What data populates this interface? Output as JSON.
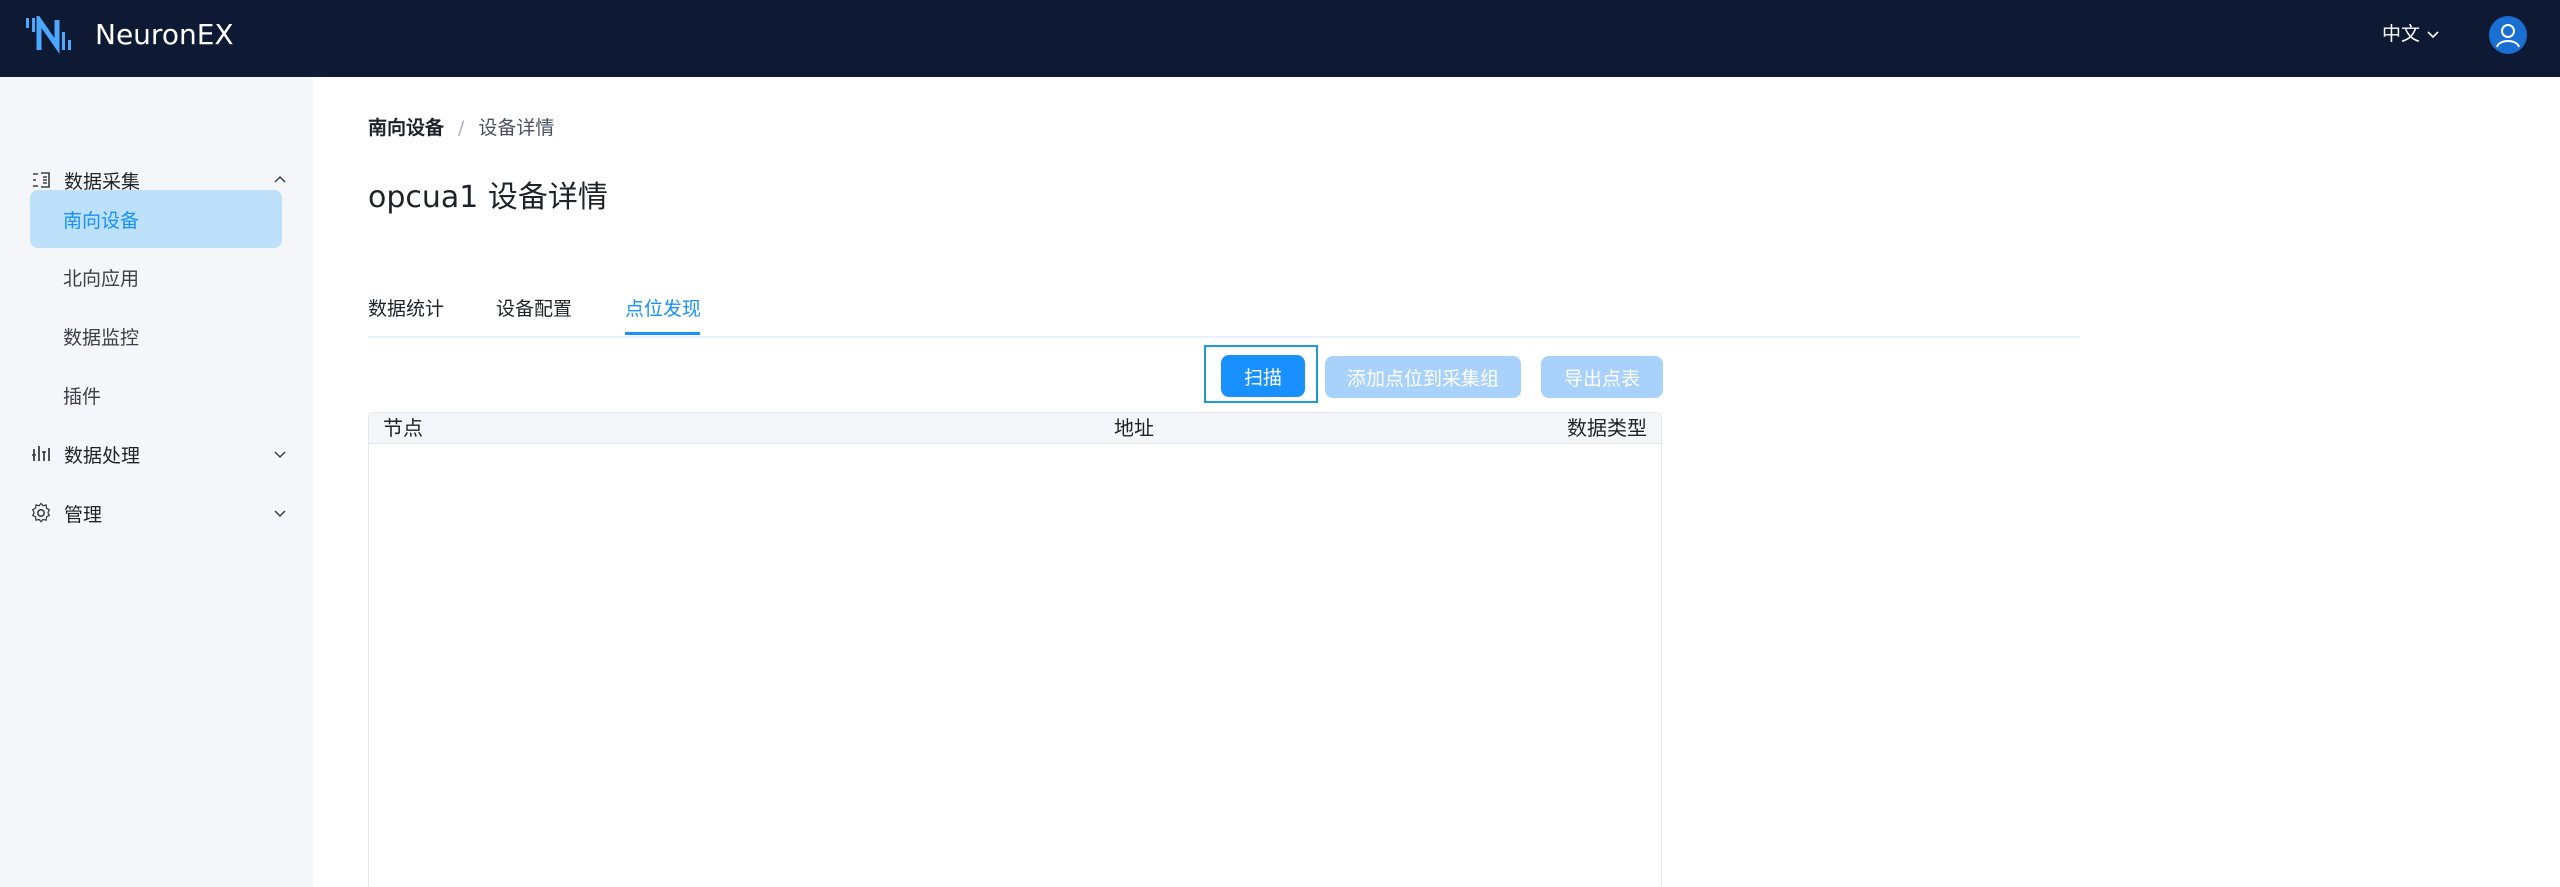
{
  "app": {
    "brand": "NeuronEX"
  },
  "header": {
    "language": "中文"
  },
  "sidebar": {
    "groups": [
      {
        "label": "数据采集",
        "icon": "data-collect-icon",
        "expanded": true,
        "items": [
          {
            "label": "南向设备",
            "active": true
          },
          {
            "label": "北向应用",
            "active": false
          },
          {
            "label": "数据监控",
            "active": false
          },
          {
            "label": "插件",
            "active": false
          }
        ]
      },
      {
        "label": "数据处理",
        "icon": "data-process-icon",
        "expanded": false
      },
      {
        "label": "管理",
        "icon": "gear-icon",
        "expanded": false
      }
    ]
  },
  "breadcrumb": {
    "root": "南向设备",
    "separator": "/",
    "current": "设备详情"
  },
  "page": {
    "title": "opcua1 设备详情"
  },
  "tabs": [
    {
      "label": "数据统计",
      "active": false
    },
    {
      "label": "设备配置",
      "active": false
    },
    {
      "label": "点位发现",
      "active": true
    }
  ],
  "actions": {
    "scan": "扫描",
    "add_to_group": "添加点位到采集组",
    "export": "导出点表"
  },
  "table": {
    "columns": [
      "节点",
      "地址",
      "数据类型"
    ],
    "rows": []
  },
  "colors": {
    "header_bg": "#0e1a33",
    "primary": "#1890ff",
    "primary_disabled": "#a8d2fb",
    "sidebar_bg": "#f5f6fa",
    "active_item_bg": "#bde0fb"
  }
}
